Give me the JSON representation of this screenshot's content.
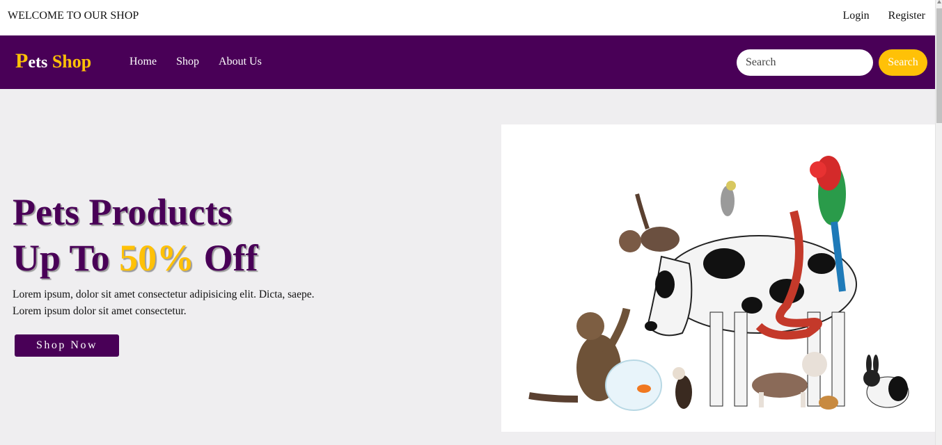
{
  "topbar": {
    "welcome": "WELCOME TO OUR SHOP",
    "login": "Login",
    "register": "Register"
  },
  "navbar": {
    "logo_p": "P",
    "logo_ets": "ets",
    "logo_shop": " Shop",
    "links": [
      "Home",
      "Shop",
      "About Us"
    ],
    "search_placeholder": "Search",
    "search_button": "Search"
  },
  "hero": {
    "title_line1": "Pets Products",
    "title_line2_pre": "Up To ",
    "title_line2_accent": "50%",
    "title_line2_post": " Off",
    "text_line1": "Lorem ipsum, dolor sit amet consectetur adipisicing elit. Dicta, saepe.",
    "text_line2": "Lorem ipsum dolor sit amet consectetur.",
    "cta": "Shop Now"
  },
  "colors": {
    "primary": "#490057",
    "accent": "#ffc107",
    "background": "#efeef0"
  },
  "icons": {
    "hero_image": "pets-group-illustration"
  }
}
